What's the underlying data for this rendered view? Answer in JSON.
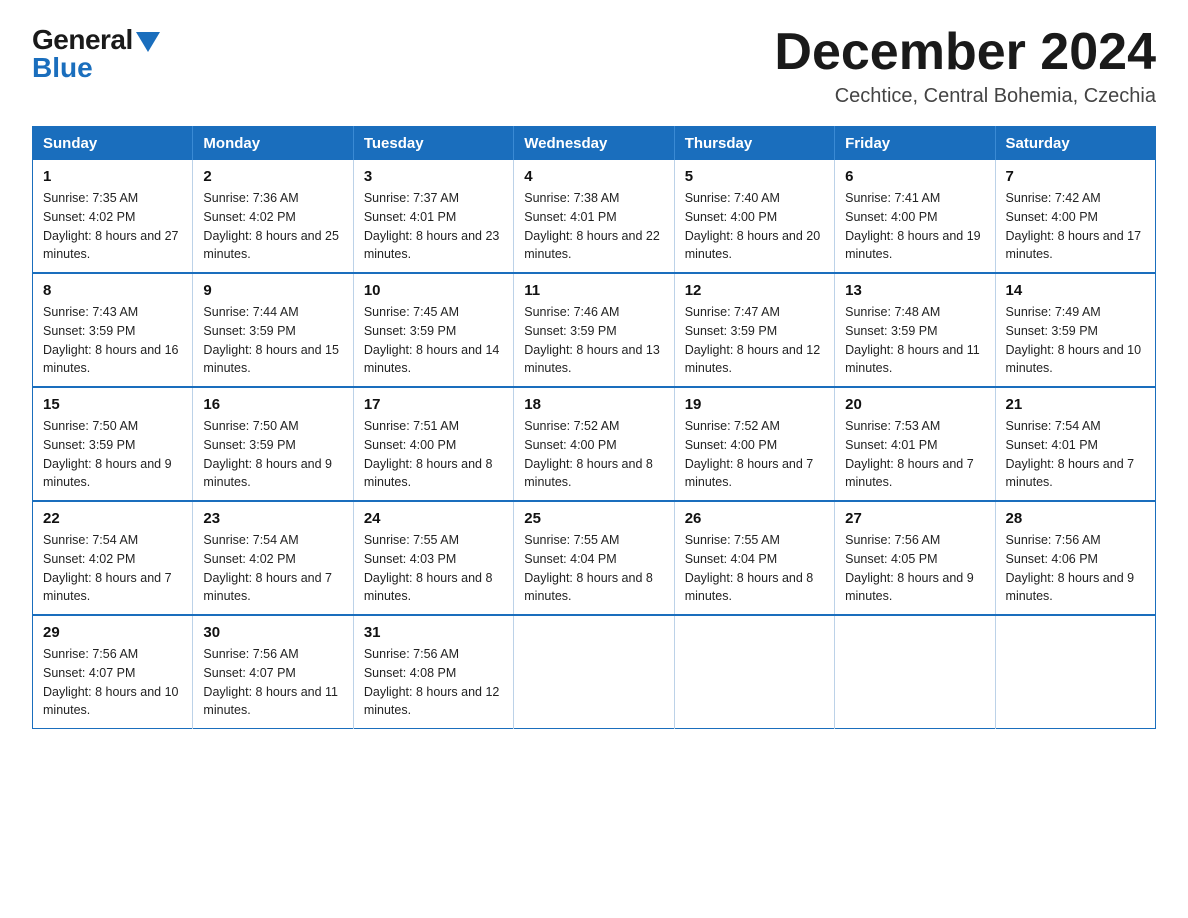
{
  "logo": {
    "general": "General",
    "blue": "Blue"
  },
  "title": "December 2024",
  "subtitle": "Cechtice, Central Bohemia, Czechia",
  "weekdays": [
    "Sunday",
    "Monday",
    "Tuesday",
    "Wednesday",
    "Thursday",
    "Friday",
    "Saturday"
  ],
  "weeks": [
    [
      {
        "day": "1",
        "sunrise": "7:35 AM",
        "sunset": "4:02 PM",
        "daylight": "8 hours and 27 minutes."
      },
      {
        "day": "2",
        "sunrise": "7:36 AM",
        "sunset": "4:02 PM",
        "daylight": "8 hours and 25 minutes."
      },
      {
        "day": "3",
        "sunrise": "7:37 AM",
        "sunset": "4:01 PM",
        "daylight": "8 hours and 23 minutes."
      },
      {
        "day": "4",
        "sunrise": "7:38 AM",
        "sunset": "4:01 PM",
        "daylight": "8 hours and 22 minutes."
      },
      {
        "day": "5",
        "sunrise": "7:40 AM",
        "sunset": "4:00 PM",
        "daylight": "8 hours and 20 minutes."
      },
      {
        "day": "6",
        "sunrise": "7:41 AM",
        "sunset": "4:00 PM",
        "daylight": "8 hours and 19 minutes."
      },
      {
        "day": "7",
        "sunrise": "7:42 AM",
        "sunset": "4:00 PM",
        "daylight": "8 hours and 17 minutes."
      }
    ],
    [
      {
        "day": "8",
        "sunrise": "7:43 AM",
        "sunset": "3:59 PM",
        "daylight": "8 hours and 16 minutes."
      },
      {
        "day": "9",
        "sunrise": "7:44 AM",
        "sunset": "3:59 PM",
        "daylight": "8 hours and 15 minutes."
      },
      {
        "day": "10",
        "sunrise": "7:45 AM",
        "sunset": "3:59 PM",
        "daylight": "8 hours and 14 minutes."
      },
      {
        "day": "11",
        "sunrise": "7:46 AM",
        "sunset": "3:59 PM",
        "daylight": "8 hours and 13 minutes."
      },
      {
        "day": "12",
        "sunrise": "7:47 AM",
        "sunset": "3:59 PM",
        "daylight": "8 hours and 12 minutes."
      },
      {
        "day": "13",
        "sunrise": "7:48 AM",
        "sunset": "3:59 PM",
        "daylight": "8 hours and 11 minutes."
      },
      {
        "day": "14",
        "sunrise": "7:49 AM",
        "sunset": "3:59 PM",
        "daylight": "8 hours and 10 minutes."
      }
    ],
    [
      {
        "day": "15",
        "sunrise": "7:50 AM",
        "sunset": "3:59 PM",
        "daylight": "8 hours and 9 minutes."
      },
      {
        "day": "16",
        "sunrise": "7:50 AM",
        "sunset": "3:59 PM",
        "daylight": "8 hours and 9 minutes."
      },
      {
        "day": "17",
        "sunrise": "7:51 AM",
        "sunset": "4:00 PM",
        "daylight": "8 hours and 8 minutes."
      },
      {
        "day": "18",
        "sunrise": "7:52 AM",
        "sunset": "4:00 PM",
        "daylight": "8 hours and 8 minutes."
      },
      {
        "day": "19",
        "sunrise": "7:52 AM",
        "sunset": "4:00 PM",
        "daylight": "8 hours and 7 minutes."
      },
      {
        "day": "20",
        "sunrise": "7:53 AM",
        "sunset": "4:01 PM",
        "daylight": "8 hours and 7 minutes."
      },
      {
        "day": "21",
        "sunrise": "7:54 AM",
        "sunset": "4:01 PM",
        "daylight": "8 hours and 7 minutes."
      }
    ],
    [
      {
        "day": "22",
        "sunrise": "7:54 AM",
        "sunset": "4:02 PM",
        "daylight": "8 hours and 7 minutes."
      },
      {
        "day": "23",
        "sunrise": "7:54 AM",
        "sunset": "4:02 PM",
        "daylight": "8 hours and 7 minutes."
      },
      {
        "day": "24",
        "sunrise": "7:55 AM",
        "sunset": "4:03 PM",
        "daylight": "8 hours and 8 minutes."
      },
      {
        "day": "25",
        "sunrise": "7:55 AM",
        "sunset": "4:04 PM",
        "daylight": "8 hours and 8 minutes."
      },
      {
        "day": "26",
        "sunrise": "7:55 AM",
        "sunset": "4:04 PM",
        "daylight": "8 hours and 8 minutes."
      },
      {
        "day": "27",
        "sunrise": "7:56 AM",
        "sunset": "4:05 PM",
        "daylight": "8 hours and 9 minutes."
      },
      {
        "day": "28",
        "sunrise": "7:56 AM",
        "sunset": "4:06 PM",
        "daylight": "8 hours and 9 minutes."
      }
    ],
    [
      {
        "day": "29",
        "sunrise": "7:56 AM",
        "sunset": "4:07 PM",
        "daylight": "8 hours and 10 minutes."
      },
      {
        "day": "30",
        "sunrise": "7:56 AM",
        "sunset": "4:07 PM",
        "daylight": "8 hours and 11 minutes."
      },
      {
        "day": "31",
        "sunrise": "7:56 AM",
        "sunset": "4:08 PM",
        "daylight": "8 hours and 12 minutes."
      },
      null,
      null,
      null,
      null
    ]
  ],
  "labels": {
    "sunrise": "Sunrise:",
    "sunset": "Sunset:",
    "daylight": "Daylight:"
  }
}
